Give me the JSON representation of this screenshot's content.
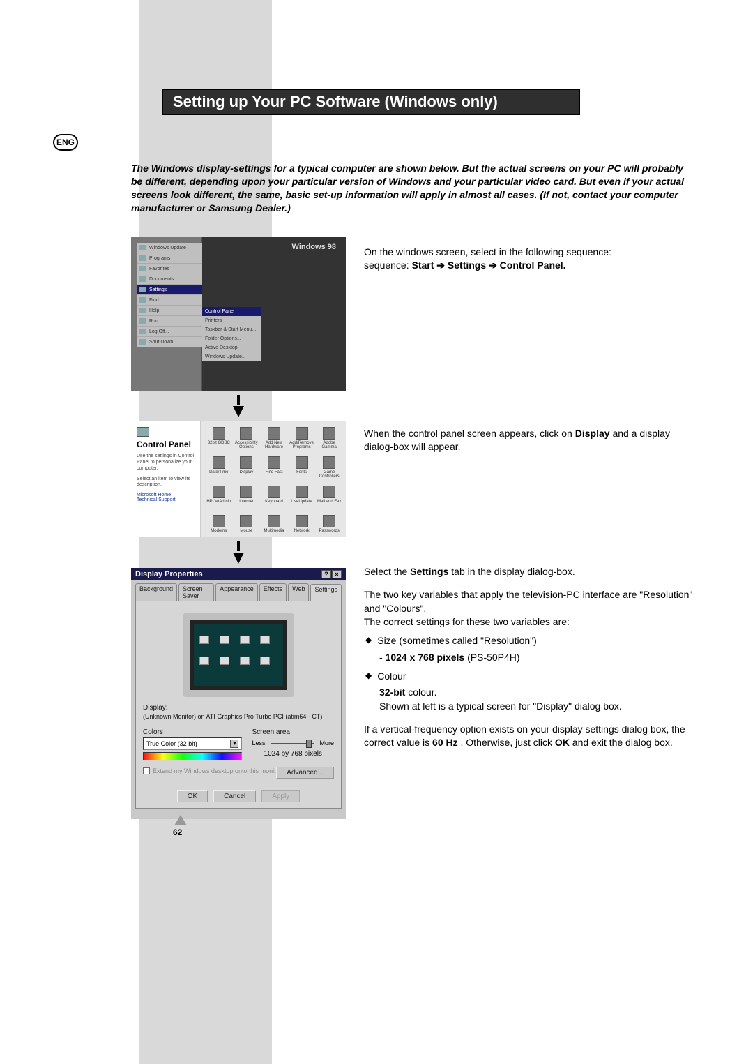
{
  "lang": "ENG",
  "title": "Setting up Your PC Software (Windows only)",
  "intro": "The Windows display-settings for a typical computer are shown below. But the actual screens on your PC will probably be different, depending upon your particular version of Windows and your particular video card. But even if your actual screens look different, the same, basic set-up information will apply in almost all cases. (If not, contact your computer manufacturer or Samsung Dealer.)",
  "figures": {
    "winlogo": "Windows 98",
    "start_menu": [
      "Windows Update",
      "Programs",
      "Favorites",
      "Documents",
      "Settings",
      "Find",
      "Help",
      "Run...",
      "Log Off...",
      "Shut Down..."
    ],
    "settings_submenu": [
      "Control Panel",
      "Printers",
      "Taskbar & Start Menu...",
      "Folder Options...",
      "Active Desktop",
      "Windows Update..."
    ],
    "control_panel": {
      "title": "Control Panel",
      "desc1": "Use the settings in Control Panel to personalize your computer.",
      "desc2": "Select an item to view its description.",
      "link1": "Microsoft Home",
      "link2": "Technical Support",
      "icons": [
        "32bit ODBC",
        "Accessibility Options",
        "Add New Hardware",
        "Add/Remove Programs",
        "Adobe Gamma",
        "Date/Time",
        "Display",
        "Find Fast",
        "Fonts",
        "Game Controllers",
        "HP JetAdmin",
        "Internet",
        "Keyboard",
        "LiveUpdate",
        "Mail and Fax",
        "Modems",
        "Mouse",
        "Multimedia",
        "Network",
        "Passwords"
      ]
    },
    "display_properties": {
      "title": "Display Properties",
      "tabs": [
        "Background",
        "Screen Saver",
        "Appearance",
        "Effects",
        "Web",
        "Settings"
      ],
      "display_label": "Display:",
      "display_value": "(Unknown Monitor) on ATI Graphics Pro Turbo PCI (atim64 - CT)",
      "colors_label": "Colors",
      "colors_value": "True Color (32 bit)",
      "screen_area_label": "Screen area",
      "less": "Less",
      "more": "More",
      "resolution": "1024 by 768 pixels",
      "extend_check": "Extend my Windows desktop onto this monitor.",
      "advanced": "Advanced...",
      "ok": "OK",
      "cancel": "Cancel",
      "apply": "Apply"
    }
  },
  "steps": {
    "s1a": "On the windows screen, select in the following sequence: ",
    "s1b_start": "Start",
    "s1b_arrow": " ➔ ",
    "s1b_settings": "Settings",
    "s1b_cp": "Control Panel.",
    "s2a": "When the control panel screen appears, click on ",
    "s2b": "Display",
    "s2c": " and a display dialog-box will appear.",
    "s3a": "Select the ",
    "s3b": "Settings",
    "s3c": " tab in the display dialog-box.",
    "s3d": "The two key variables that apply the television-PC interface are \"Resolution\" and \"Colours\".",
    "s3e": "The correct settings for these two variables are:",
    "s3_bul1": "Size (sometimes called \"Resolution\")",
    "s3_bul1_sub_a": "- ",
    "s3_bul1_sub_b": "1024 x 768 pixels",
    "s3_bul1_sub_c": " (PS-50P4H)",
    "s3_bul2": "Colour",
    "s3_bul2_sub_a": "32-bit",
    "s3_bul2_sub_b": " colour.",
    "s3_bul2_sub_c": "Shown at left is a typical screen for \"Display\" dialog box.",
    "s3f_a": "If a vertical-frequency option exists on your display settings dialog box, the correct value is ",
    "s3f_b": "60 Hz",
    "s3f_c": ". Otherwise, just click ",
    "s3f_d": "OK",
    "s3f_e": " and exit the dialog box."
  },
  "page_number": "62"
}
